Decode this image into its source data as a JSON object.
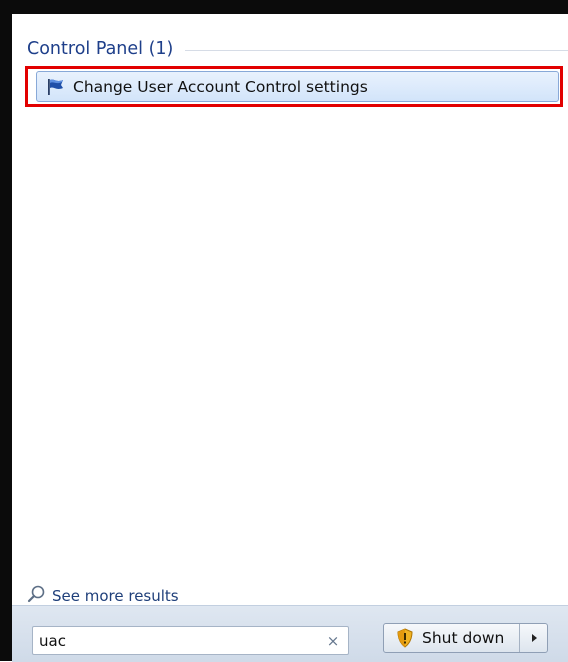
{
  "results": {
    "section_title": "Control Panel (1)",
    "items": [
      {
        "label": "Change User Account Control settings",
        "icon": "uac-flag-icon"
      }
    ]
  },
  "footer": {
    "see_more_label": "See more results",
    "search_value": "uac",
    "clear_icon_glyph": "×",
    "shutdown_label": "Shut down"
  },
  "colors": {
    "section_title": "#1e3f8a",
    "highlight_border": "#e20000",
    "selected_item_bg": "#d2e4fa"
  }
}
